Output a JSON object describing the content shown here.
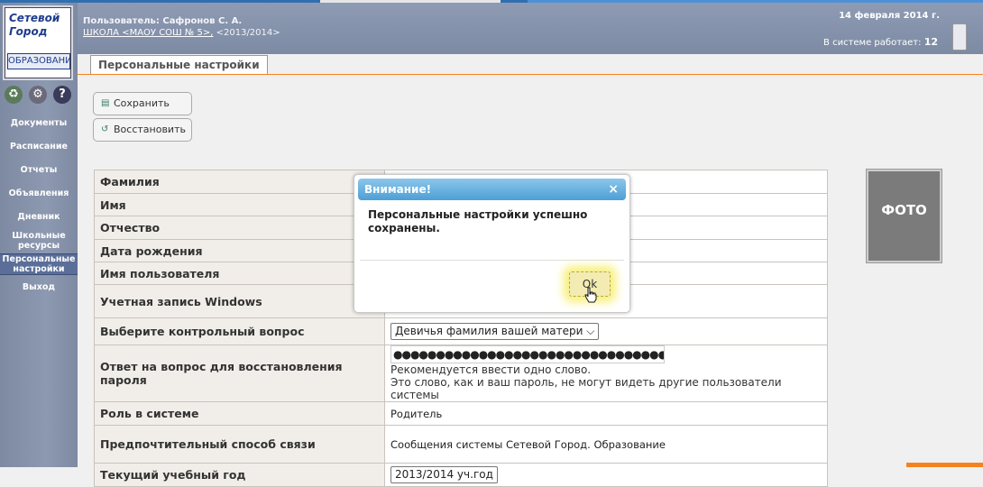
{
  "header": {
    "user": "Пользователь: Сафронов С. А.",
    "school_link": "ШКОЛА <МАОУ СОШ № 5>,",
    "year": "<2013/2014>",
    "date": "14 февраля 2014 г.",
    "online_label": "В системе работает:",
    "online_count": "12"
  },
  "logo": {
    "line1": "Сетевой",
    "line2": "Город",
    "line3": "ОБРАЗОВАНИЕ"
  },
  "sidebar": {
    "icons": [
      "recycle-icon",
      "settings-icon",
      "help-icon"
    ],
    "items": [
      {
        "label": "Документы"
      },
      {
        "label": "Расписание"
      },
      {
        "label": "Отчеты"
      },
      {
        "label": "Объявления"
      },
      {
        "label": "Дневник"
      },
      {
        "label": "Школьные ресурсы"
      },
      {
        "label": "Персональные настройки"
      },
      {
        "label": "Выход"
      }
    ]
  },
  "tab": {
    "label": "Персональные настройки"
  },
  "buttons": {
    "save": "Сохранить",
    "restore": "Восстановить"
  },
  "form": {
    "labels": {
      "lastname": "Фамилия",
      "firstname": "Имя",
      "patronymic": "Отчество",
      "birthdate": "Дата рождения",
      "username": "Имя пользователя",
      "windows": "Учетная запись Windows",
      "question": "Выберите контрольный вопрос",
      "answer": "Ответ на вопрос для восстановления пароля",
      "role": "Роль в системе",
      "contact": "Предпочтительный способ связи",
      "last": "Текущий учебный год"
    },
    "values": {
      "question": "Девичья фамилия вашей матери",
      "answer_mask": "●●●●●●●●●●●●●●●●●●●●●●●●●●●●●●●●",
      "answer_hint1": "Рекомендуется ввести одно слово.",
      "answer_hint2": "Это слово, как и ваш пароль, не могут видеть другие пользователи системы",
      "role": "Родитель",
      "contact": "Сообщения системы Сетевой Город. Образование",
      "last": "2013/2014 уч.год"
    }
  },
  "photo": {
    "label": "ФОТО"
  },
  "modal": {
    "title": "Внимание!",
    "close": "×",
    "message": "Персональные настройки успешно сохранены.",
    "ok": "Ok"
  }
}
